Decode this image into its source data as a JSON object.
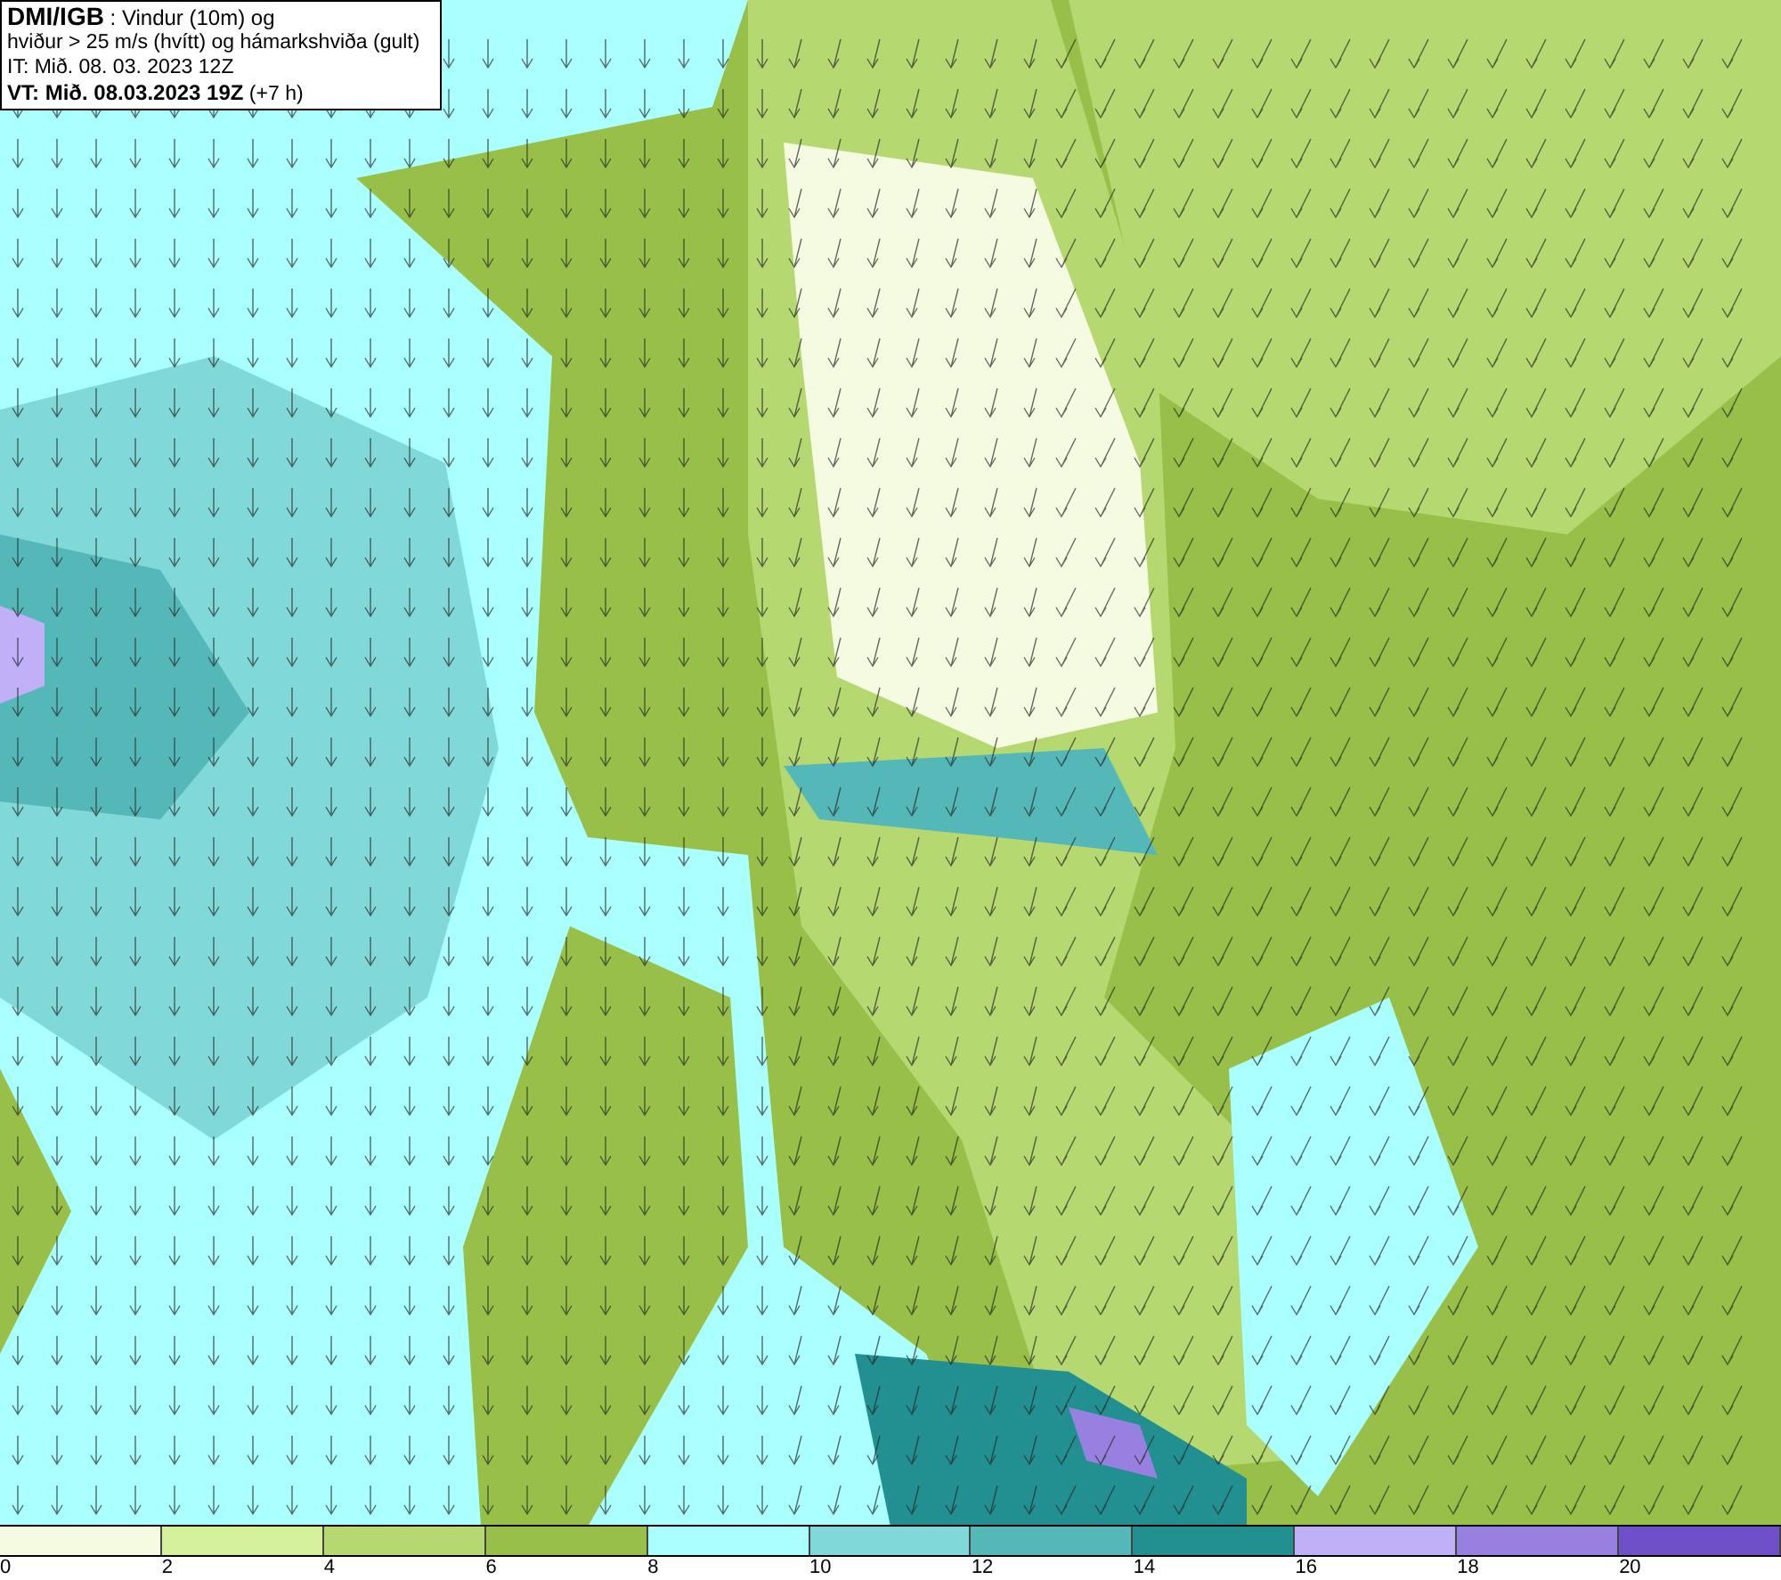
{
  "title_box": {
    "lines": [
      "**DMI/IGB** : Vindur (10m) og",
      "hviður > 25 m/s (hvítt) og hámarkshviða (gult)",
      "IT: Mið. 08. 03. 2023 12Z",
      "**VT: Mið. 08.03.2023 19Z** (+7 h)"
    ]
  },
  "legend": [
    {
      "label": "0",
      "color": "#f5fbe0"
    },
    {
      "label": "2",
      "color": "#d4f09a"
    },
    {
      "label": "4",
      "color": "#b5d870"
    },
    {
      "label": "6",
      "color": "#98c048"
    },
    {
      "label": "8",
      "color": "#aaffff"
    },
    {
      "label": "10",
      "color": "#80d8d8"
    },
    {
      "label": "12",
      "color": "#55b8b8"
    },
    {
      "label": "14",
      "color": "#229090"
    },
    {
      "label": "16",
      "color": "#c0b0f8"
    },
    {
      "label": "18",
      "color": "#9880e0"
    },
    {
      "label": "20",
      "color": "#7050c8"
    }
  ]
}
